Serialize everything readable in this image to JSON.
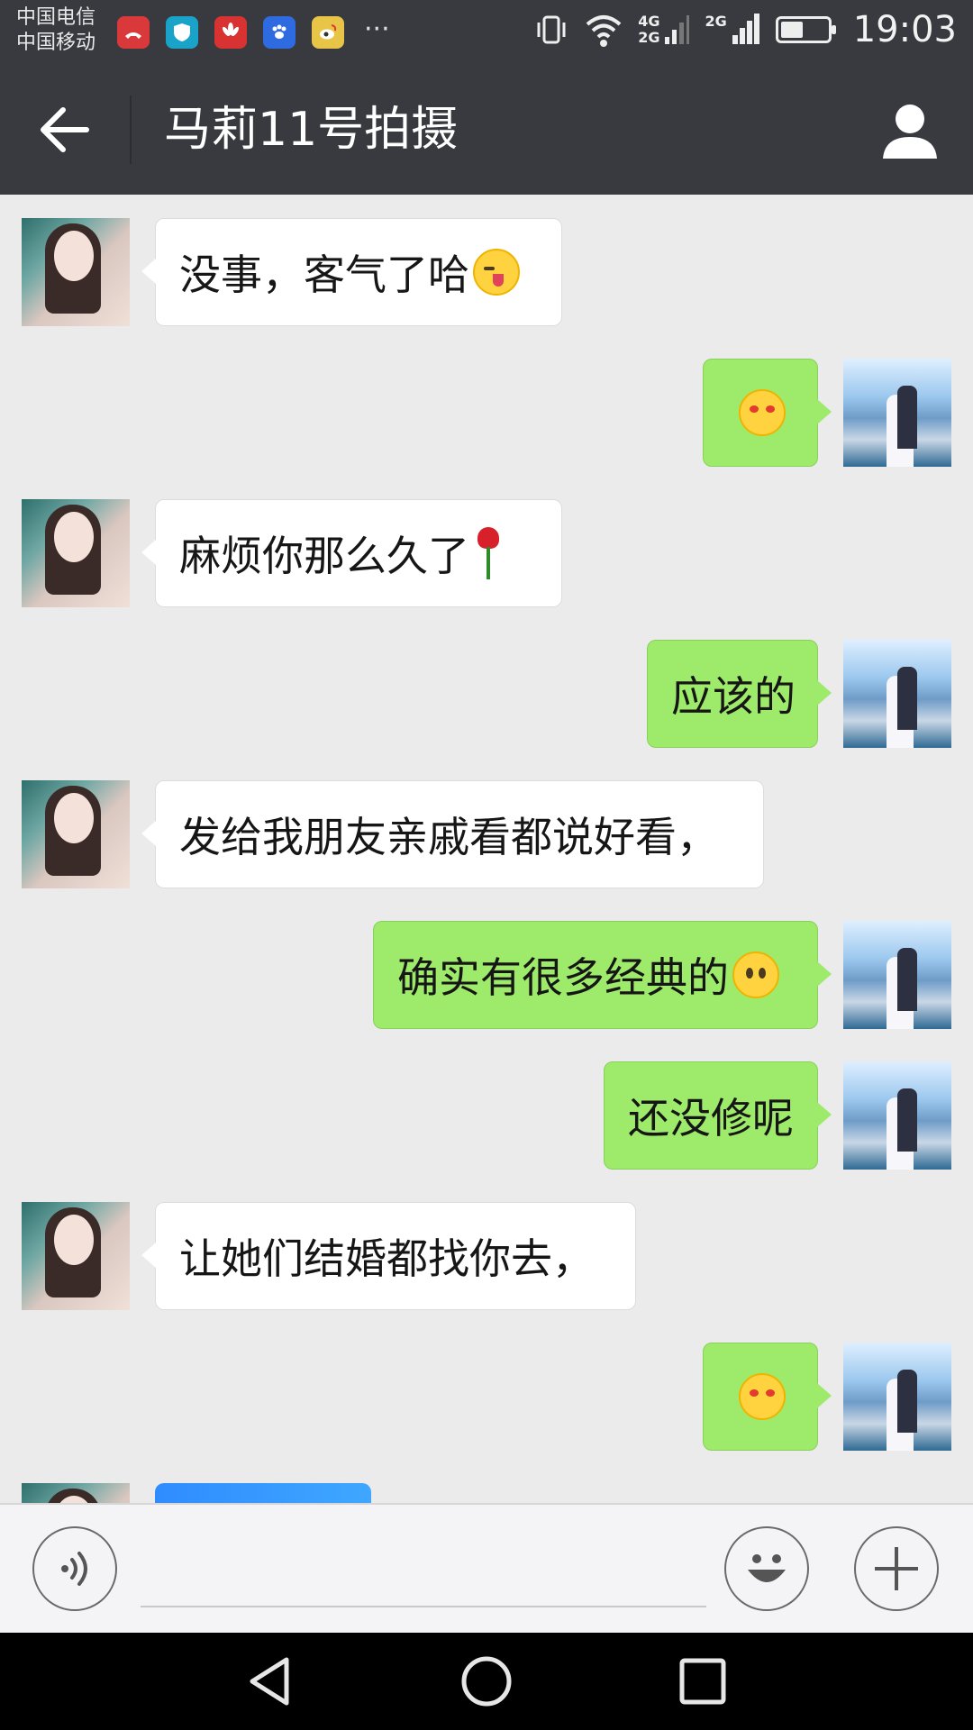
{
  "status_bar": {
    "carrier_1": "中国电信",
    "carrier_2": "中国移动",
    "more": "···",
    "net_1": "4G",
    "net_2": "2G",
    "net_3": "2G",
    "time": "19:03"
  },
  "header": {
    "title": "马莉11号拍摄"
  },
  "messages": [
    {
      "side": "left",
      "text": "没事，客气了哈",
      "emoji": "wink"
    },
    {
      "side": "right",
      "text": "",
      "emoji": "blush"
    },
    {
      "side": "left",
      "text": "麻烦你那么久了",
      "emoji": "rose"
    },
    {
      "side": "right",
      "text": "应该的"
    },
    {
      "side": "left",
      "text": "发给我朋友亲戚看都说好看，"
    },
    {
      "side": "right",
      "text": "确实有很多经典的",
      "emoji": "smile"
    },
    {
      "side": "right",
      "text": "还没修呢"
    },
    {
      "side": "left",
      "text": "让她们结婚都找你去，"
    },
    {
      "side": "right",
      "text": "",
      "emoji": "blush"
    },
    {
      "side": "left",
      "text": "",
      "attachment": "screenshot-image"
    }
  ],
  "input": {
    "value": "",
    "placeholder": ""
  },
  "icons": {
    "back": "back-arrow-icon",
    "profile": "person-icon",
    "voice": "voice-icon",
    "emoji": "emoji-face-icon",
    "more": "plus-icon"
  },
  "colors": {
    "header": "#393a3f",
    "chat_bg": "#ebebeb",
    "outgoing_bubble": "#9eea6a",
    "incoming_bubble": "#ffffff"
  }
}
